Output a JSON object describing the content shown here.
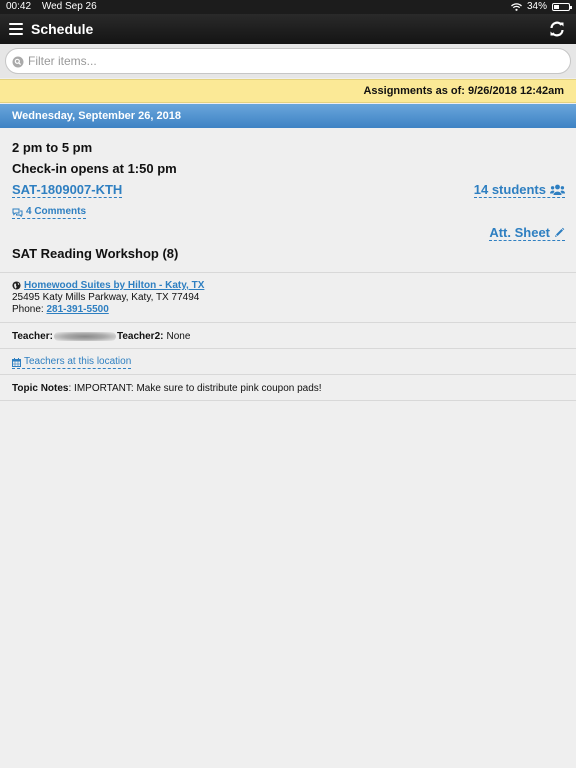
{
  "status_bar": {
    "time": "00:42",
    "date": "Wed Sep 26",
    "battery": "34%",
    "battery_level": 0.34
  },
  "nav": {
    "title": "Schedule"
  },
  "filter": {
    "placeholder": "Filter items..."
  },
  "as_of": "Assignments as of: 9/26/2018 12:42am",
  "date_header": "Wednesday, September 26, 2018",
  "session": {
    "time": "2 pm to 5 pm",
    "checkin": "Check-in opens at 1:50 pm",
    "code": "SAT-1809007-KTH",
    "students": "14 students",
    "comments": "4 Comments",
    "att_sheet": "Att. Sheet",
    "title": "SAT Reading Workshop (8)"
  },
  "location": {
    "name": "Homewood Suites by Hilton - Katy, TX",
    "address": "25495 Katy Mills Parkway, Katy, TX 77494",
    "phone_label": "Phone:",
    "phone": "281-391-5500"
  },
  "teachers": {
    "teacher_label": "Teacher:",
    "teacher2_label": "Teacher2:",
    "teacher2_value": "None"
  },
  "teachers_link": "Teachers at this location",
  "topic_notes": {
    "label": "Topic Notes",
    "text": ": IMPORTANT: Make sure to distribute pink coupon pads!"
  },
  "colors": {
    "link": "#2e7fc1",
    "as_of_bg": "#fbe996",
    "date_bar": "#4a8fcf",
    "nav_bg": "#1c1c1c",
    "page_bg": "#efefef"
  },
  "icons": [
    "hamburger-icon",
    "refresh-icon",
    "search-icon",
    "users-icon",
    "comments-icon",
    "pencil-icon",
    "globe-icon",
    "calendar-icon",
    "wifi-icon",
    "battery-icon"
  ]
}
